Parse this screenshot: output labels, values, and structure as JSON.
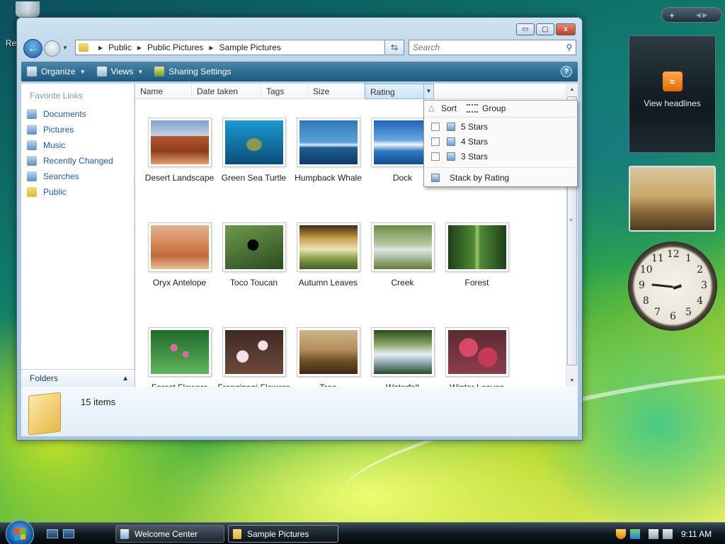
{
  "desktop": {
    "partial_label": "Re"
  },
  "window": {
    "controls": {
      "minimize": "▭",
      "maximize": "▢",
      "close": "x"
    },
    "address": {
      "crumbs": [
        "Public",
        "Public Pictures",
        "Sample Pictures"
      ]
    },
    "search": {
      "placeholder": "Search"
    },
    "toolbar": {
      "organize": "Organize",
      "views": "Views",
      "sharing": "Sharing Settings",
      "help": "?"
    },
    "navpane": {
      "header": "Favorite Links",
      "links": [
        "Documents",
        "Pictures",
        "Music",
        "Recently Changed",
        "Searches",
        "Public"
      ],
      "folders": "Folders"
    },
    "columns": [
      "Name",
      "Date taken",
      "Tags",
      "Size",
      "Rating"
    ],
    "items": [
      {
        "name": "Desert Landscape",
        "thumb": "desert"
      },
      {
        "name": "Green Sea Turtle",
        "thumb": "turtle"
      },
      {
        "name": "Humpback Whale",
        "thumb": "whale"
      },
      {
        "name": "Dock",
        "thumb": "dock"
      },
      {
        "name": "",
        "thumb": "hidden"
      },
      {
        "name": "Oryx Antelope",
        "thumb": "oryx"
      },
      {
        "name": "Toco Toucan",
        "thumb": "toucan"
      },
      {
        "name": "Autumn Leaves",
        "thumb": "autumn"
      },
      {
        "name": "Creek",
        "thumb": "creek"
      },
      {
        "name": "Forest",
        "thumb": "forest"
      },
      {
        "name": "Forest Flowers",
        "thumb": "flowers"
      },
      {
        "name": "Frangipani Flowers",
        "thumb": "frangipani"
      },
      {
        "name": "Tree",
        "thumb": "tree"
      },
      {
        "name": "Waterfall",
        "thumb": "waterfall"
      },
      {
        "name": "Winter Leaves",
        "thumb": "winter"
      }
    ],
    "rating_menu": {
      "sort": "Sort",
      "group": "Group",
      "options": [
        "5 Stars",
        "4 Stars",
        "3 Stars"
      ],
      "stack": "Stack by Rating"
    },
    "details": {
      "count": "15 items"
    }
  },
  "sidebar": {
    "feeds_label": "View headlines",
    "rss": "≈",
    "top_plus": "+",
    "top_nav": "◀ ▶",
    "clock_numbers": [
      "12",
      "1",
      "2",
      "3",
      "4",
      "5",
      "6",
      "7",
      "8",
      "9",
      "10",
      "11"
    ]
  },
  "taskbar": {
    "tasks": [
      "Welcome Center",
      "Sample Pictures"
    ],
    "time": "9:11 AM"
  }
}
